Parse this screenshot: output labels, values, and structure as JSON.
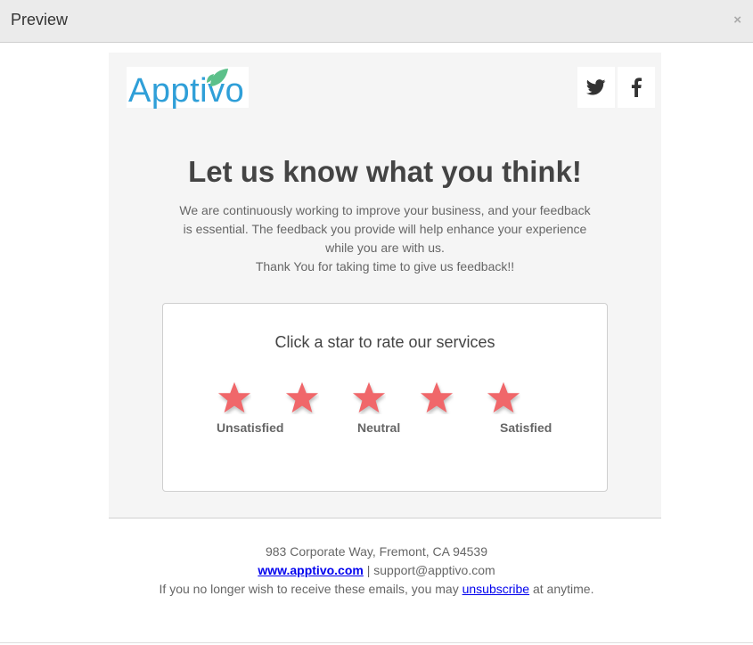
{
  "window": {
    "title": "Preview",
    "close_glyph": "×"
  },
  "brand": {
    "logo_text": "Apptivo",
    "logo_color": "#2f9fd8",
    "leaf_color": "#5cc08a"
  },
  "social": [
    {
      "name": "twitter-icon",
      "glyph": "twitter"
    },
    {
      "name": "facebook-icon",
      "glyph": "f"
    }
  ],
  "content": {
    "headline": "Let us know what you think!",
    "paragraph_lines": [
      "We are continuously working to improve your business, and your feedback",
      "is essential. The feedback you provide will help enhance your experience",
      "while you are with us.",
      "Thank You for taking time to give us feedback!!"
    ]
  },
  "rating": {
    "prompt": "Click a star to rate our services",
    "star_count": 5,
    "star_color": "#f0676a",
    "labels": [
      "Unsatisfied",
      "Neutral",
      "Satisfied"
    ]
  },
  "footer": {
    "address": "983 Corporate Way, Fremont, CA 94539",
    "website": "www.apptivo.com",
    "separator": " | ",
    "email": "support@apptivo.com",
    "unsub_prefix": "If you no longer wish to receive these emails, you may ",
    "unsub_link": "unsubscribe",
    "unsub_suffix": " at anytime."
  }
}
